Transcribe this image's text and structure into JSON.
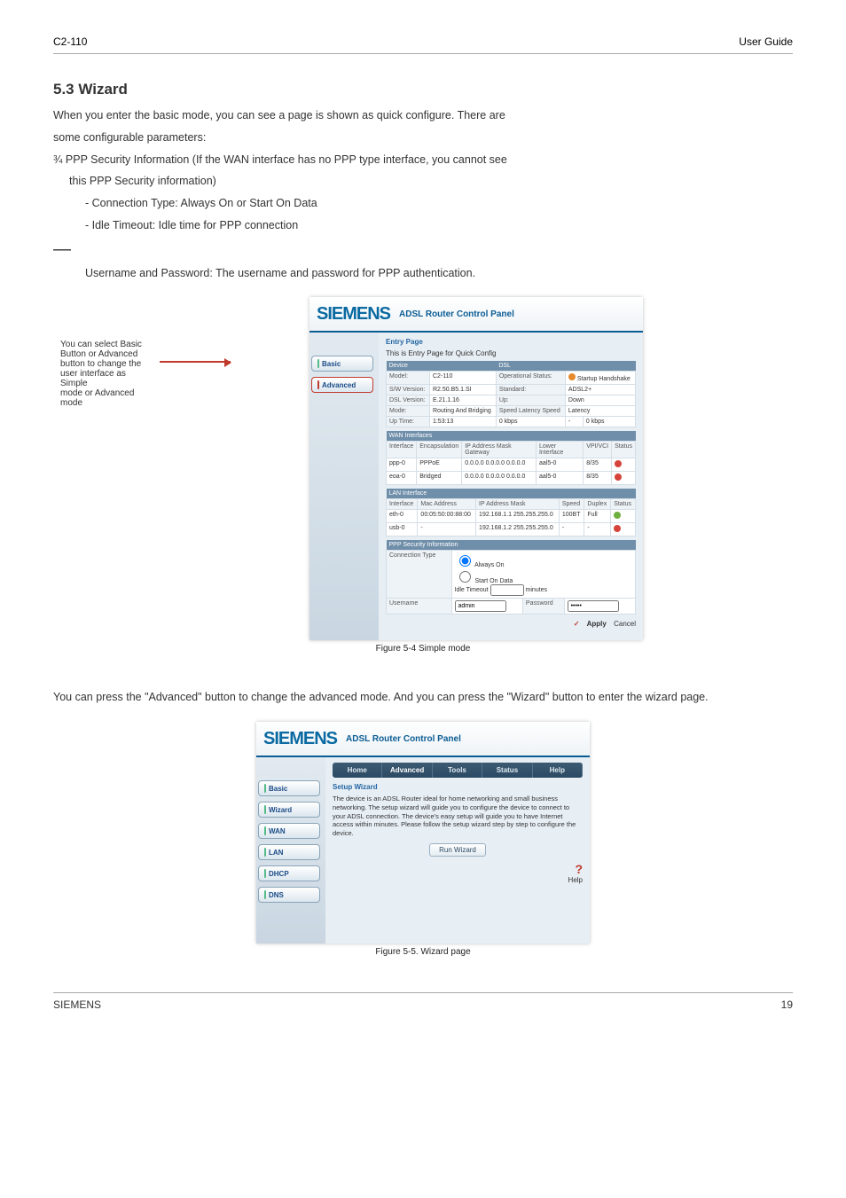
{
  "header": {
    "product": "C2-110",
    "doc": "User Guide"
  },
  "title_section": "5.3 Wizard",
  "intro": {
    "p1": "When you enter the basic mode, you can see a page is shown as quick configure. There are",
    "p2": "some configurable parameters:",
    "b1": "¾ PPP Security Information (If the WAN interface has no PPP type interface, you cannot see",
    "b2": "this PPP Security information)",
    "b3": "- Connection Type: Always On or Start On Data",
    "b4": "- Idle Timeout: Idle time for PPP connection",
    "b5_dash": "—",
    "b6": "Username and Password: The username and password for PPP authentication."
  },
  "annotation": {
    "l1": "You can select Basic",
    "l2": "Button or Advanced",
    "l3": "button to change the",
    "l4": "user interface as Simple",
    "l5": "mode or Advanced",
    "l6": "mode"
  },
  "fig1": {
    "brand": "SIEMENS",
    "subtitle": "ADSL Router Control Panel",
    "side_basic": "Basic",
    "side_advanced": "Advanced",
    "crumb": "Entry Page",
    "desc": "This is Entry Page for Quick Config",
    "device": "Device",
    "dsl": "DSL",
    "model_lbl": "Model:",
    "model_val": "C2-110",
    "opstatus_lbl": "Operational Status:",
    "opstatus_val": "Startup Handshake",
    "sw_lbl": "S/W Version:",
    "sw_val": "R2.50.B5.1.SI",
    "std_lbl": "Standard:",
    "std_val": "ADSL2+",
    "dslver_lbl": "DSL Version:",
    "dslver_val": "E.21.1.16",
    "up_lbl": "Up:",
    "down_lbl": "Down",
    "mode_lbl": "Mode:",
    "mode_val": "Routing And Bridging",
    "speedlat": "Speed Latency Speed",
    "latency": "Latency",
    "uptime_lbl": "Up Time:",
    "uptime_val": "1:53:13",
    "kbps0": "0 kbps",
    "kbps1": "0 kbps",
    "wan_hdr": "WAN Interfaces",
    "iface_lbl": "Interface",
    "encap_lbl": "Encapsulation",
    "ipmask_lbl": "IP Address Mask Gateway",
    "lower_lbl": "Lower Interface",
    "vpi_lbl": "VPI/VCI",
    "status_lbl": "Status",
    "ppp0": "ppp-0",
    "pppoe": "PPPoE",
    "zeros": "0.0.0.0 0.0.0.0 0.0.0.0",
    "aal5": "aal5-0",
    "r835": "8/35",
    "eoa0": "eoa-0",
    "bridged": "Bridged",
    "lan_hdr": "LAN Interface",
    "mac_lbl": "Mac Address",
    "ipmask2_lbl": "IP Address Mask",
    "speed_lbl": "Speed",
    "duplex_lbl": "Duplex",
    "eth0": "eth-0",
    "mac": "00:05:50:00:88:00",
    "ip1": "192.168.1.1 255.255.255.0",
    "s100": "100BT",
    "full": "Full",
    "usb0": "usb-0",
    "ip2": "192.168.1.2 255.255.255.0",
    "ppp_hdr": "PPP Security Information",
    "conntype_lbl": "Connection Type",
    "always": "Always On",
    "startod": "Start On Data",
    "idle": "Idle Timeout",
    "minutes": "minutes",
    "user_lbl": "Username",
    "user_val": "admin",
    "pass_lbl": "Password",
    "pass_val": "*****",
    "apply": "Apply",
    "cancel": "Cancel",
    "caption": "Figure 5-4 Simple mode"
  },
  "para2": "You can press the \"Advanced\" button to change the advanced mode. And you can press the \"Wizard\" button to enter the wizard page.",
  "fig2": {
    "brand": "SIEMENS",
    "subtitle": "ADSL Router Control Panel",
    "tabs": {
      "home": "Home",
      "adv": "Advanced",
      "tools": "Tools",
      "status": "Status",
      "help": "Help"
    },
    "side": {
      "basic": "Basic",
      "wizard": "Wizard",
      "wan": "WAN",
      "lan": "LAN",
      "dhcp": "DHCP",
      "dns": "DNS"
    },
    "crumb": "Setup Wizard",
    "text": "The device is an ADSL Router ideal for home networking and small business networking. The setup wizard will guide you to configure the device to connect to your ADSL connection. The device's easy setup will guide you to have Internet access within minutes. Please follow the setup wizard step by step to configure the device.",
    "run": "Run Wizard",
    "help": "Help",
    "caption": "Figure 5-5. Wizard page"
  },
  "footer": {
    "brand": "SIEMENS",
    "page": "19"
  }
}
